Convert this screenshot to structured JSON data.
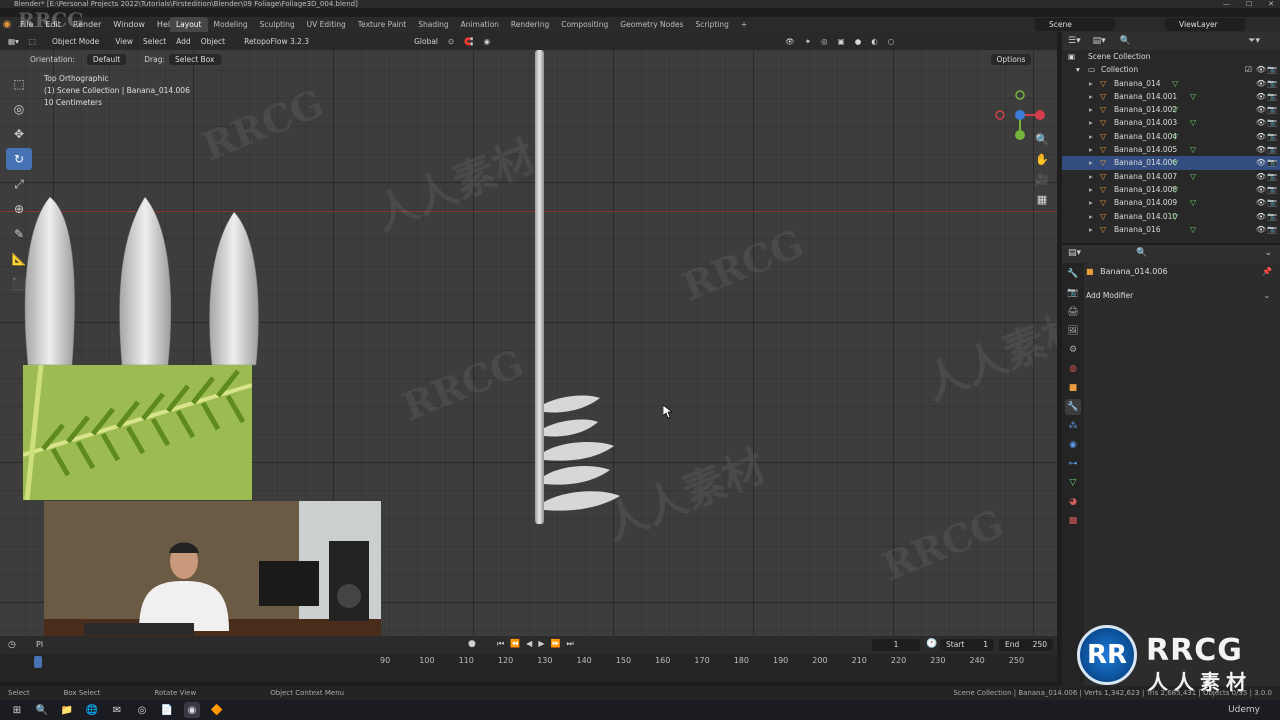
{
  "titlebar": {
    "text": "Blender* [E:\\Personal Projects 2022\\Tutorials\\Firstedition\\Blender\\09 Foliage\\Foliage3D_004.blend]",
    "win_controls": [
      "—",
      "☐",
      "✕"
    ]
  },
  "menu": [
    "File",
    "Edit",
    "Render",
    "Window",
    "Help"
  ],
  "workspace_tabs": [
    "Layout",
    "Modeling",
    "Sculpting",
    "UV Editing",
    "Texture Paint",
    "Shading",
    "Animation",
    "Rendering",
    "Compositing",
    "Geometry Nodes",
    "Scripting",
    "+"
  ],
  "active_tab": "Layout",
  "scene": "Scene",
  "view_layer": "ViewLayer",
  "viewport_header": {
    "mode": "Object Mode",
    "menus": [
      "View",
      "Select",
      "Add",
      "Object"
    ],
    "addon": "RetopoFlow 3.2.3",
    "transform": "Global"
  },
  "tool_settings": {
    "orientation_label": "Orientation:",
    "orientation_value": "Default",
    "drag_label": "Drag:",
    "drag_value": "Select Box",
    "options": "Options"
  },
  "viewport_info": {
    "view": "Top Orthographic",
    "collection": "(1) Scene Collection | Banana_014.006",
    "scale": "10 Centimeters"
  },
  "tools": [
    "⬚",
    "◎",
    "✥",
    "↻",
    "⤢",
    "⊕",
    "✎",
    "📐",
    "⬛"
  ],
  "timeline": {
    "playback": "Pl",
    "current_frame": "1",
    "start_label": "Start",
    "start": "1",
    "end_label": "End",
    "end": "250",
    "ticks": [
      "90",
      "100",
      "110",
      "120",
      "130",
      "140",
      "150",
      "160",
      "170",
      "180",
      "190",
      "200",
      "210",
      "220",
      "230",
      "240",
      "250"
    ]
  },
  "outliner": {
    "root": "Scene Collection",
    "collection": "Collection",
    "objects": [
      "Banana_014",
      "Banana_014.001",
      "Banana_014.002",
      "Banana_014.003",
      "Banana_014.004",
      "Banana_014.005",
      "Banana_014.006",
      "Banana_014.007",
      "Banana_014.008",
      "Banana_014.009",
      "Banana_014.010",
      "Banana_016"
    ],
    "selected": "Banana_014.006"
  },
  "properties": {
    "object_name": "Banana_014.006",
    "add_modifier": "Add Modifier"
  },
  "statusbar": {
    "select": "Select",
    "box_select": "Box Select",
    "rotate_view": "Rotate View",
    "context_menu": "Object Context Menu",
    "stats": "Scene Collection | Banana_014.006 | Verts 1,342,623 | Tris 2,685,431 | Objects 0/35 | 3.0.0"
  },
  "branding": {
    "logo_letters": "RR",
    "rrcg": "RRCG",
    "sub": "人人素材",
    "watermark_a": "RRCG",
    "watermark_b": "人人素材",
    "udemy": "Udemy"
  },
  "colors": {
    "accent": "#4772b3",
    "selected_row": "#334d80",
    "x_axis": "#d23c4b",
    "y_axis": "#74b43a",
    "z_axis": "#3d7bd8",
    "fern": "#8fb14a"
  }
}
